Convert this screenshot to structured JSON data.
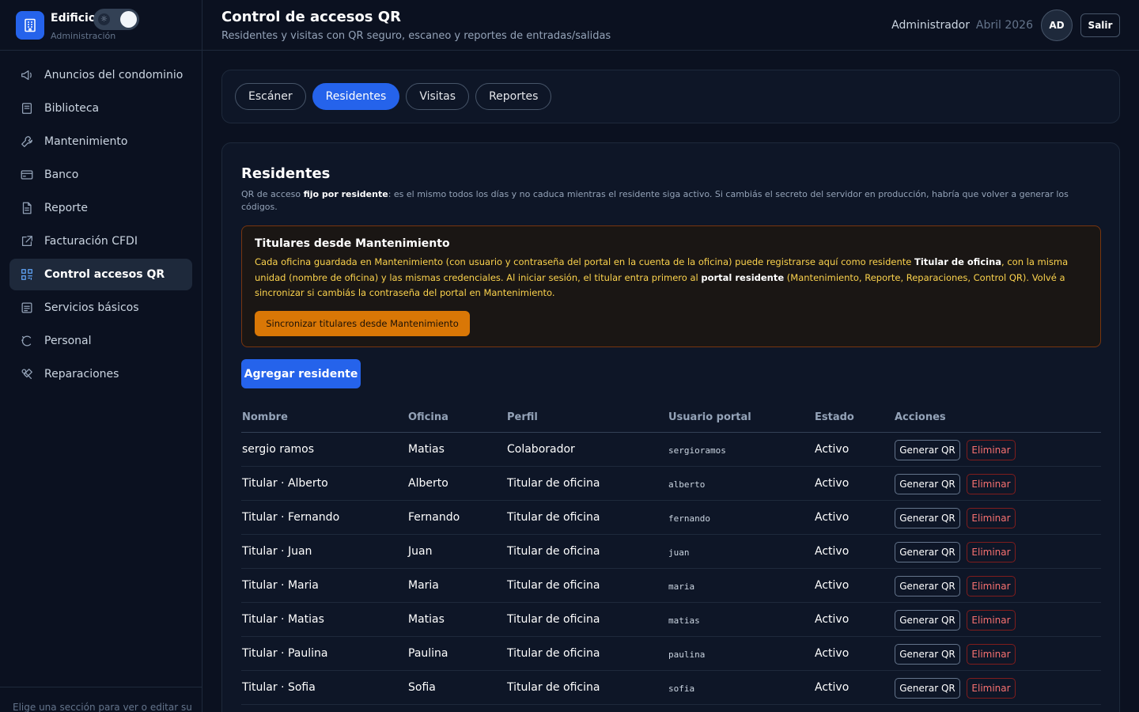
{
  "brand": {
    "name": "Edificio",
    "subtitle": "Administración",
    "theme_icon": "sun-icon"
  },
  "sidebar": {
    "items": [
      {
        "label": "Anuncios del condominio",
        "icon": "megaphone-icon",
        "active": false
      },
      {
        "label": "Biblioteca",
        "icon": "book-icon",
        "active": false
      },
      {
        "label": "Mantenimiento",
        "icon": "wrench-icon",
        "active": false
      },
      {
        "label": "Banco",
        "icon": "card-icon",
        "active": false
      },
      {
        "label": "Reporte",
        "icon": "document-icon",
        "active": false
      },
      {
        "label": "Facturación CFDI",
        "icon": "external-edit-icon",
        "active": false
      },
      {
        "label": "Control accesos QR",
        "icon": "grid-icon",
        "active": true
      },
      {
        "label": "Servicios básicos",
        "icon": "list-icon",
        "active": false
      },
      {
        "label": "Personal",
        "icon": "loader-icon",
        "active": false
      },
      {
        "label": "Reparaciones",
        "icon": "tools-icon",
        "active": false
      }
    ],
    "footer": "Elige una sección para ver o editar su"
  },
  "header": {
    "title": "Control de accesos QR",
    "subtitle": "Residentes y visitas con QR seguro, escaneo y reportes de entradas/salidas",
    "user_role": "Administrador",
    "date": "Abril 2026",
    "avatar": "AD",
    "logout": "Salir"
  },
  "tabs": [
    {
      "label": "Escáner",
      "active": false
    },
    {
      "label": "Residentes",
      "active": true
    },
    {
      "label": "Visitas",
      "active": false
    },
    {
      "label": "Reportes",
      "active": false
    }
  ],
  "section": {
    "title": "Residentes",
    "desc_1": "QR de acceso ",
    "desc_bold": "fijo por residente",
    "desc_2": ": es el mismo todos los días y no caduca mientras el residente siga activo. Si cambiás el secreto del servidor en producción, habría que volver a generar los códigos."
  },
  "notice": {
    "title": "Titulares desde Mantenimiento",
    "body_1": "Cada oficina guardada en Mantenimiento (con usuario y contraseña del portal en la cuenta de la oficina) puede registrarse aquí como residente ",
    "body_bold_1": "Titular de oficina",
    "body_2": ", con la misma unidad (nombre de oficina) y las mismas credenciales. Al iniciar sesión, el titular entra primero al ",
    "body_bold_2": "portal residente",
    "body_3": " (Mantenimiento, Reporte, Reparaciones, Control QR). Volvé a sincronizar si cambiás la contraseña del portal en Mantenimiento.",
    "button": "Sincronizar titulares desde Mantenimiento"
  },
  "add_button": "Agregar residente",
  "table": {
    "headers": [
      "Nombre",
      "Oficina",
      "Perfil",
      "Usuario portal",
      "Estado",
      "Acciones"
    ],
    "action_qr": "Generar QR",
    "action_delete": "Eliminar",
    "rows": [
      {
        "nombre": "sergio ramos",
        "oficina": "Matias",
        "perfil": "Colaborador",
        "usuario": "sergioramos",
        "estado": "Activo"
      },
      {
        "nombre": "Titular · Alberto",
        "oficina": "Alberto",
        "perfil": "Titular de oficina",
        "usuario": "alberto",
        "estado": "Activo"
      },
      {
        "nombre": "Titular · Fernando",
        "oficina": "Fernando",
        "perfil": "Titular de oficina",
        "usuario": "fernando",
        "estado": "Activo"
      },
      {
        "nombre": "Titular · Juan",
        "oficina": "Juan",
        "perfil": "Titular de oficina",
        "usuario": "juan",
        "estado": "Activo"
      },
      {
        "nombre": "Titular · Maria",
        "oficina": "Maria",
        "perfil": "Titular de oficina",
        "usuario": "maria",
        "estado": "Activo"
      },
      {
        "nombre": "Titular · Matias",
        "oficina": "Matias",
        "perfil": "Titular de oficina",
        "usuario": "matias",
        "estado": "Activo"
      },
      {
        "nombre": "Titular · Paulina",
        "oficina": "Paulina",
        "perfil": "Titular de oficina",
        "usuario": "paulina",
        "estado": "Activo"
      },
      {
        "nombre": "Titular · Sofia",
        "oficina": "Sofia",
        "perfil": "Titular de oficina",
        "usuario": "sofia",
        "estado": "Activo"
      }
    ]
  },
  "colors": {
    "accent": "#2563eb",
    "warning": "#d97706",
    "danger": "#f87171",
    "background": "#0b1120"
  }
}
